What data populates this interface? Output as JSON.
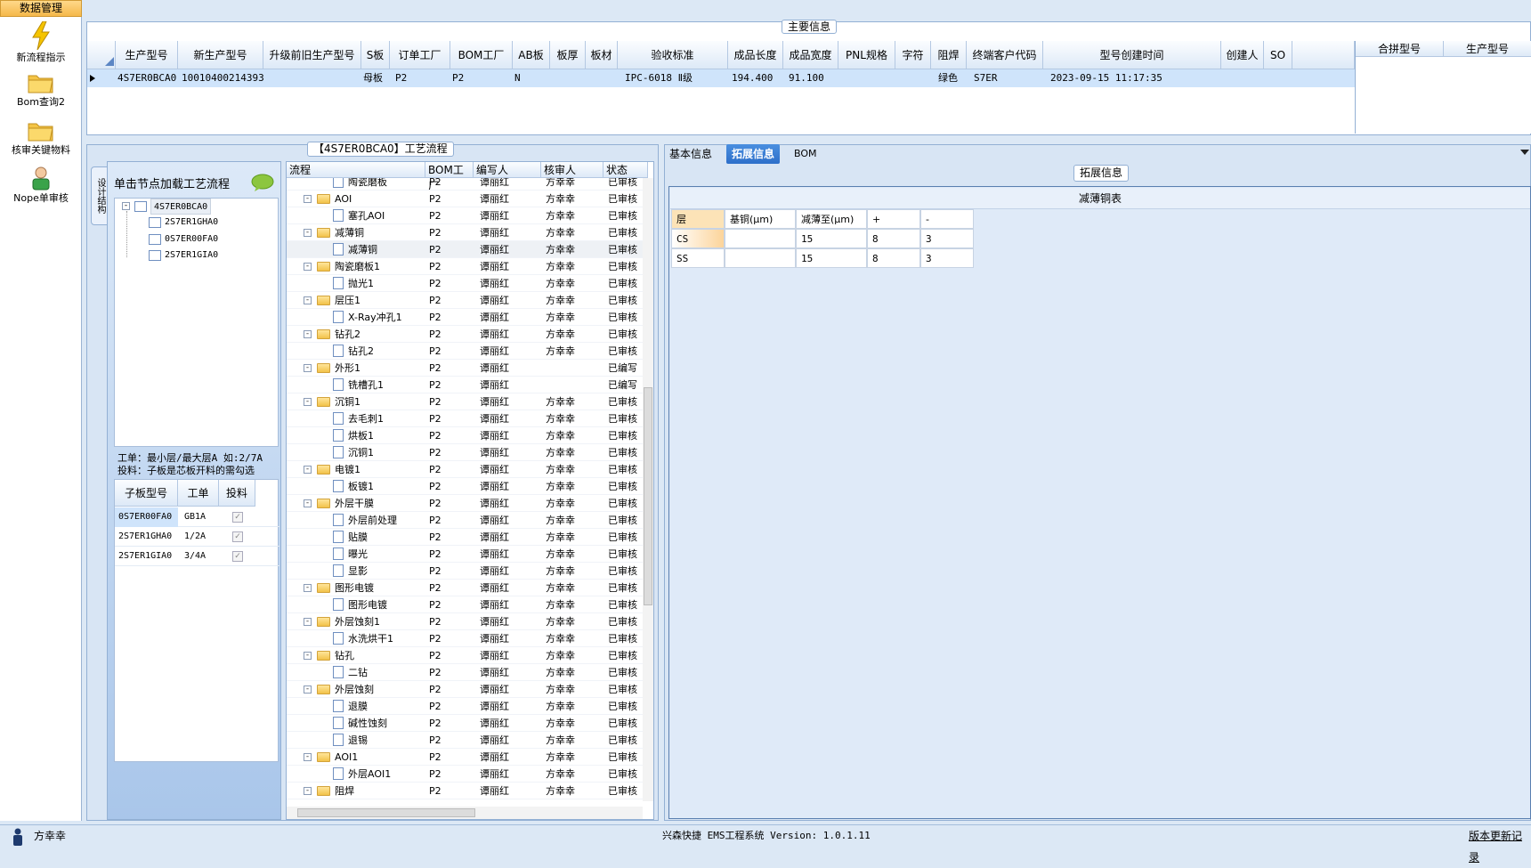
{
  "nav": {
    "header": "数据管理",
    "items": [
      {
        "label": "新流程指示",
        "icon": "lightning-icon"
      },
      {
        "label": "Bom查询2",
        "icon": "folder-icon"
      },
      {
        "label": "核审关键物料",
        "icon": "folder-icon"
      },
      {
        "label": "Nope单审核",
        "icon": "user-icon"
      }
    ]
  },
  "main_info": {
    "title": "主要信息",
    "columns": [
      "生产型号",
      "新生产型号",
      "升级前旧生产型号",
      "S板",
      "订单工厂",
      "BOM工厂",
      "AB板",
      "板厚",
      "板材",
      "验收标准",
      "成品长度",
      "成品宽度",
      "PNL规格",
      "字符",
      "阻焊",
      "终端客户代码",
      "型号创建时间",
      "创建人",
      "SO"
    ],
    "row": {
      "prod_model": "4S7ER0BCA0",
      "new_model": "10010400214393",
      "old_model": "",
      "s_board": "母板",
      "order_factory": "P2",
      "bom_factory": "P2",
      "ab_board": "N",
      "thickness": "",
      "material": "",
      "standard": "IPC-6018 Ⅱ级",
      "length": "194.400",
      "width": "91.100",
      "pnl": "",
      "char": "",
      "mask": "绿色",
      "customer": "S7ER",
      "created": "2023-09-15 11:17:35",
      "creator": "",
      "so": ""
    },
    "merge_columns": [
      "合拼型号",
      "生产型号"
    ]
  },
  "flow": {
    "title": "【4S7ER0BCA0】工艺流程",
    "side_tab": "设计结构",
    "pane_header": "单击节点加载工艺流程",
    "tree": [
      "4S7ER0BCA0",
      "2S7ER1GHA0",
      "0S7ER00FA0",
      "2S7ER1GIA0"
    ],
    "hint1": "工单：最小层/最大层A 如:2/7A",
    "hint2": "投料：子板是芯板开料的需勾选",
    "sub_columns": [
      "子板型号",
      "工单",
      "投料"
    ],
    "sub_rows": [
      {
        "model": "0S7ER00FA0",
        "order": "GB1A"
      },
      {
        "model": "2S7ER1GHA0",
        "order": "1/2A"
      },
      {
        "model": "2S7ER1GIA0",
        "order": "3/4A"
      }
    ],
    "columns": [
      "流程",
      "BOM工厂",
      "编写人",
      "核审人",
      "状态"
    ],
    "rows": [
      {
        "name": "陶瓷磨板",
        "level": 2,
        "factory": "P2",
        "writer": "谭丽红",
        "checker": "方幸幸",
        "status": "已审核"
      },
      {
        "name": "AOI",
        "level": 1,
        "factory": "P2",
        "writer": "谭丽红",
        "checker": "方幸幸",
        "status": "已审核"
      },
      {
        "name": "塞孔AOI",
        "level": 2,
        "factory": "P2",
        "writer": "谭丽红",
        "checker": "方幸幸",
        "status": "已审核"
      },
      {
        "name": "减薄铜",
        "level": 1,
        "factory": "P2",
        "writer": "谭丽红",
        "checker": "方幸幸",
        "status": "已审核"
      },
      {
        "name": "减薄铜",
        "level": 2,
        "factory": "P2",
        "writer": "谭丽红",
        "checker": "方幸幸",
        "status": "已审核"
      },
      {
        "name": "陶瓷磨板1",
        "level": 1,
        "factory": "P2",
        "writer": "谭丽红",
        "checker": "方幸幸",
        "status": "已审核"
      },
      {
        "name": "抛光1",
        "level": 2,
        "factory": "P2",
        "writer": "谭丽红",
        "checker": "方幸幸",
        "status": "已审核"
      },
      {
        "name": "层压1",
        "level": 1,
        "factory": "P2",
        "writer": "谭丽红",
        "checker": "方幸幸",
        "status": "已审核"
      },
      {
        "name": "X-Ray冲孔1",
        "level": 2,
        "factory": "P2",
        "writer": "谭丽红",
        "checker": "方幸幸",
        "status": "已审核"
      },
      {
        "name": "钻孔2",
        "level": 1,
        "factory": "P2",
        "writer": "谭丽红",
        "checker": "方幸幸",
        "status": "已审核"
      },
      {
        "name": "钻孔2",
        "level": 2,
        "factory": "P2",
        "writer": "谭丽红",
        "checker": "方幸幸",
        "status": "已审核"
      },
      {
        "name": "外形1",
        "level": 1,
        "factory": "P2",
        "writer": "谭丽红",
        "checker": "",
        "status": "已编写"
      },
      {
        "name": "铣槽孔1",
        "level": 2,
        "factory": "P2",
        "writer": "谭丽红",
        "checker": "",
        "status": "已编写"
      },
      {
        "name": "沉铜1",
        "level": 1,
        "factory": "P2",
        "writer": "谭丽红",
        "checker": "方幸幸",
        "status": "已审核"
      },
      {
        "name": "去毛刺1",
        "level": 2,
        "factory": "P2",
        "writer": "谭丽红",
        "checker": "方幸幸",
        "status": "已审核"
      },
      {
        "name": "烘板1",
        "level": 2,
        "factory": "P2",
        "writer": "谭丽红",
        "checker": "方幸幸",
        "status": "已审核"
      },
      {
        "name": "沉铜1",
        "level": 2,
        "factory": "P2",
        "writer": "谭丽红",
        "checker": "方幸幸",
        "status": "已审核"
      },
      {
        "name": "电镀1",
        "level": 1,
        "factory": "P2",
        "writer": "谭丽红",
        "checker": "方幸幸",
        "status": "已审核"
      },
      {
        "name": "板镀1",
        "level": 2,
        "factory": "P2",
        "writer": "谭丽红",
        "checker": "方幸幸",
        "status": "已审核"
      },
      {
        "name": "外层干膜",
        "level": 1,
        "factory": "P2",
        "writer": "谭丽红",
        "checker": "方幸幸",
        "status": "已审核"
      },
      {
        "name": "外层前处理",
        "level": 2,
        "factory": "P2",
        "writer": "谭丽红",
        "checker": "方幸幸",
        "status": "已审核"
      },
      {
        "name": "贴膜",
        "level": 2,
        "factory": "P2",
        "writer": "谭丽红",
        "checker": "方幸幸",
        "status": "已审核"
      },
      {
        "name": "曝光",
        "level": 2,
        "factory": "P2",
        "writer": "谭丽红",
        "checker": "方幸幸",
        "status": "已审核"
      },
      {
        "name": "显影",
        "level": 2,
        "factory": "P2",
        "writer": "谭丽红",
        "checker": "方幸幸",
        "status": "已审核"
      },
      {
        "name": "图形电镀",
        "level": 1,
        "factory": "P2",
        "writer": "谭丽红",
        "checker": "方幸幸",
        "status": "已审核"
      },
      {
        "name": "图形电镀",
        "level": 2,
        "factory": "P2",
        "writer": "谭丽红",
        "checker": "方幸幸",
        "status": "已审核"
      },
      {
        "name": "外层蚀刻1",
        "level": 1,
        "factory": "P2",
        "writer": "谭丽红",
        "checker": "方幸幸",
        "status": "已审核"
      },
      {
        "name": "水洗烘干1",
        "level": 2,
        "factory": "P2",
        "writer": "谭丽红",
        "checker": "方幸幸",
        "status": "已审核"
      },
      {
        "name": "钻孔",
        "level": 1,
        "factory": "P2",
        "writer": "谭丽红",
        "checker": "方幸幸",
        "status": "已审核"
      },
      {
        "name": "二钻",
        "level": 2,
        "factory": "P2",
        "writer": "谭丽红",
        "checker": "方幸幸",
        "status": "已审核"
      },
      {
        "name": "外层蚀刻",
        "level": 1,
        "factory": "P2",
        "writer": "谭丽红",
        "checker": "方幸幸",
        "status": "已审核"
      },
      {
        "name": "退膜",
        "level": 2,
        "factory": "P2",
        "writer": "谭丽红",
        "checker": "方幸幸",
        "status": "已审核"
      },
      {
        "name": "碱性蚀刻",
        "level": 2,
        "factory": "P2",
        "writer": "谭丽红",
        "checker": "方幸幸",
        "status": "已审核"
      },
      {
        "name": "退锡",
        "level": 2,
        "factory": "P2",
        "writer": "谭丽红",
        "checker": "方幸幸",
        "status": "已审核"
      },
      {
        "name": "AOI1",
        "level": 1,
        "factory": "P2",
        "writer": "谭丽红",
        "checker": "方幸幸",
        "status": "已审核"
      },
      {
        "name": "外层AOI1",
        "level": 2,
        "factory": "P2",
        "writer": "谭丽红",
        "checker": "方幸幸",
        "status": "已审核"
      },
      {
        "name": "阻焊",
        "level": 1,
        "factory": "P2",
        "writer": "谭丽红",
        "checker": "方幸幸",
        "status": "已审核"
      }
    ]
  },
  "right": {
    "tabs": [
      "基本信息",
      "拓展信息",
      "BOM"
    ],
    "ext_title": "拓展信息",
    "table_title": "减薄铜表",
    "columns": [
      "层",
      "基铜(μm)",
      "减薄至(μm)",
      "+",
      "-"
    ],
    "rows": [
      {
        "layer": "CS",
        "base": "",
        "thin": "15",
        "plus": "8",
        "minus": "3"
      },
      {
        "layer": "SS",
        "base": "",
        "thin": "15",
        "plus": "8",
        "minus": "3"
      }
    ]
  },
  "status": {
    "user": "方幸幸",
    "system": "兴森快捷 EMS工程系统 Version: 1.0.1.11",
    "update": "版本更新记录"
  },
  "colors": {
    "accent": "#2d6fca",
    "selected_row": "#cfe4fb",
    "folder": "#f2c24a"
  }
}
